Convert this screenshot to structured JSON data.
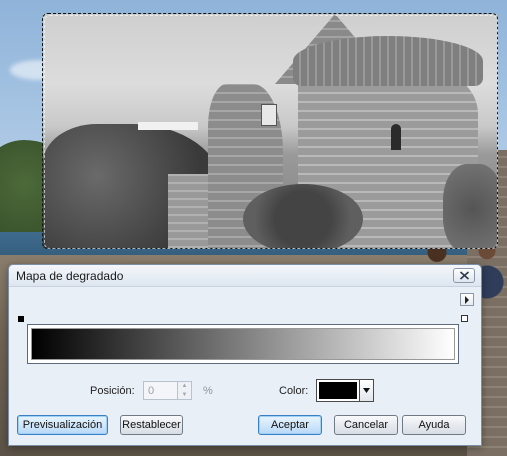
{
  "dialog": {
    "title": "Mapa de degradado",
    "close_icon": "close-icon",
    "flyout_icon": "triangle-right-icon"
  },
  "gradient": {
    "start_color": "#000000",
    "end_color": "#ffffff"
  },
  "controls": {
    "position_label": "Posición:",
    "position_value": "0",
    "percent_label": "%",
    "color_label": "Color:",
    "color_value": "#000000"
  },
  "buttons": {
    "preview": "Previsualización",
    "reset": "Restablecer",
    "ok": "Aceptar",
    "cancel": "Cancelar",
    "help": "Ayuda"
  }
}
